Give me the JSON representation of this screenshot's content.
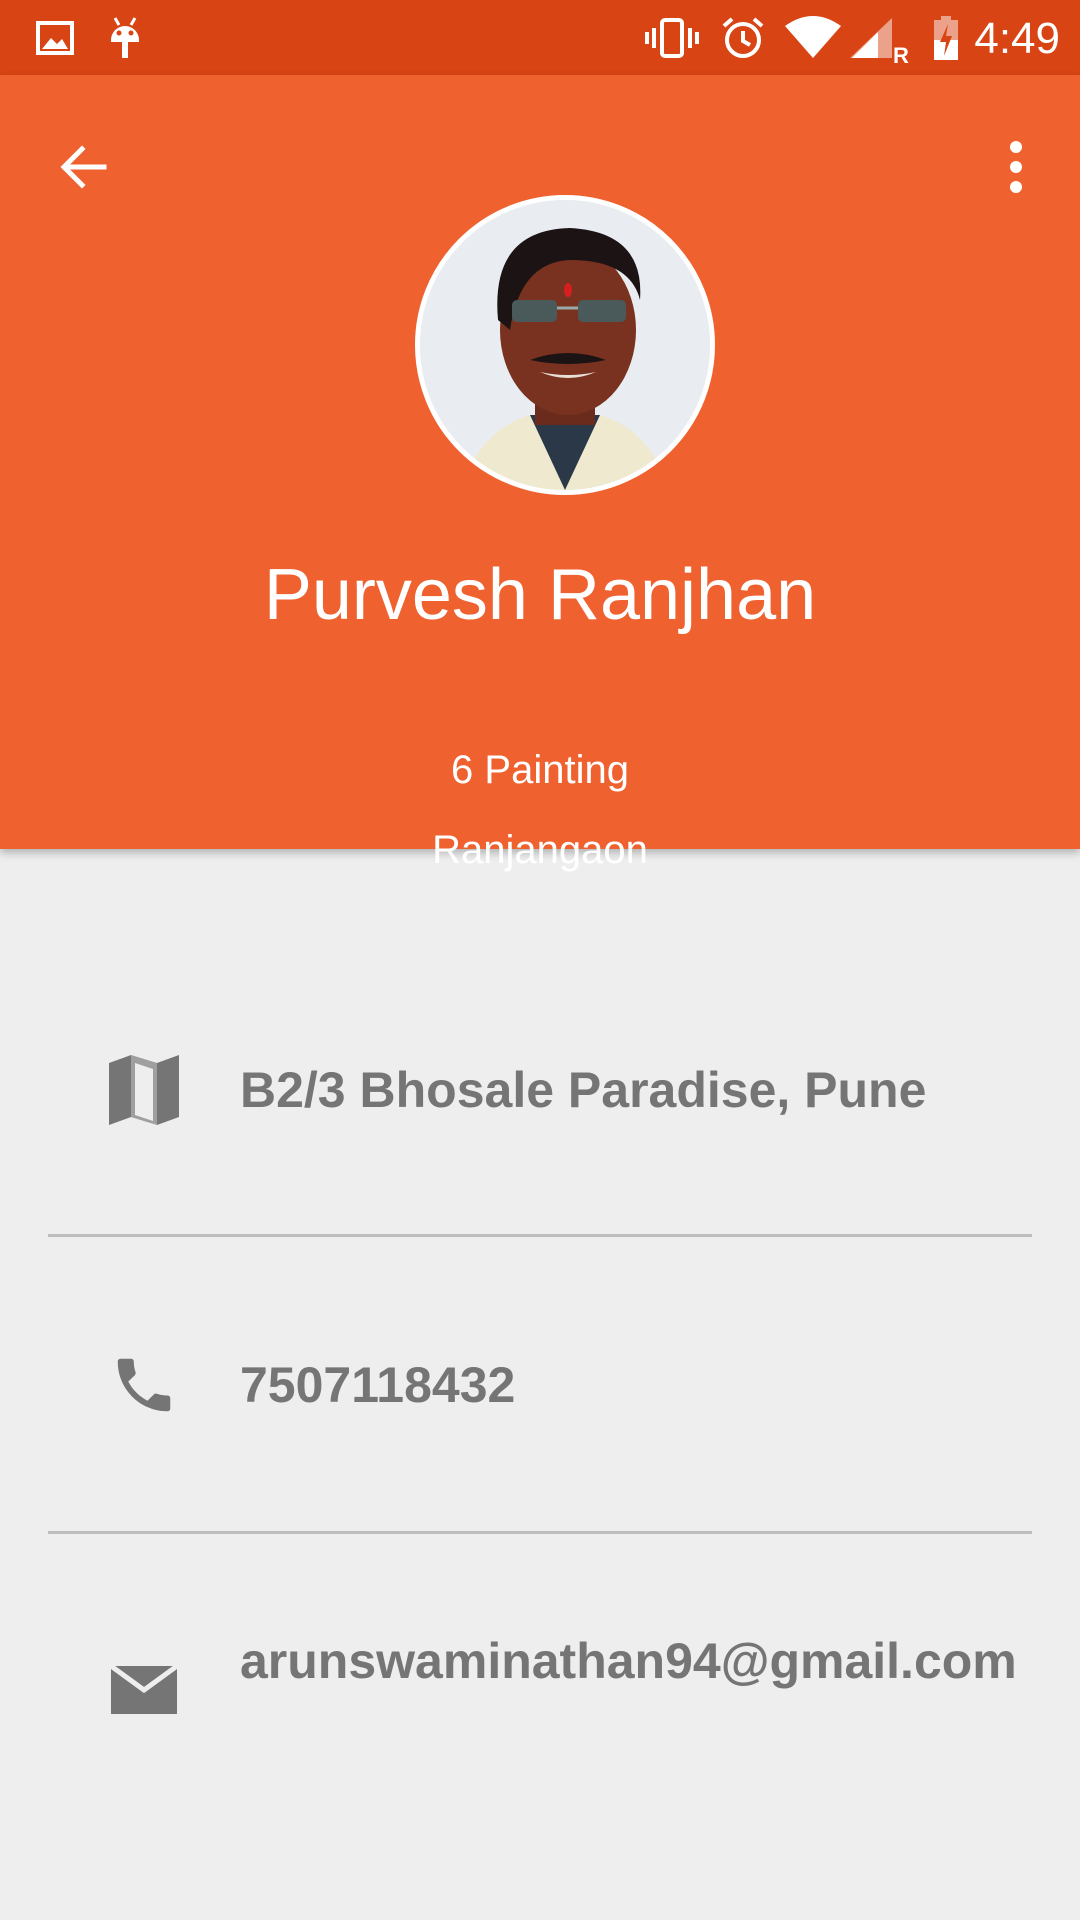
{
  "status_bar": {
    "time": "4:49",
    "bg_color": "#d84414",
    "icons": [
      "image-icon",
      "android-icon",
      "vibrate-icon",
      "alarm-icon",
      "wifi-icon",
      "signal-icon",
      "roaming-indicator",
      "battery-charging-icon"
    ],
    "roaming_label": "R"
  },
  "header": {
    "bg_color": "#ef6230",
    "back_icon": "arrow-back-icon",
    "more_icon": "more-vert-icon"
  },
  "profile": {
    "name": "Purvesh Ranjhan",
    "trade": "6 Painting",
    "town": "Ranjangaon"
  },
  "details": {
    "address": {
      "icon": "map-icon",
      "text": "B2/3 Bhosale Paradise, Pune"
    },
    "phone": {
      "icon": "phone-icon",
      "text": "7507118432"
    },
    "email": {
      "icon": "email-icon",
      "text": "arunswaminathan94@gmail.com"
    }
  }
}
